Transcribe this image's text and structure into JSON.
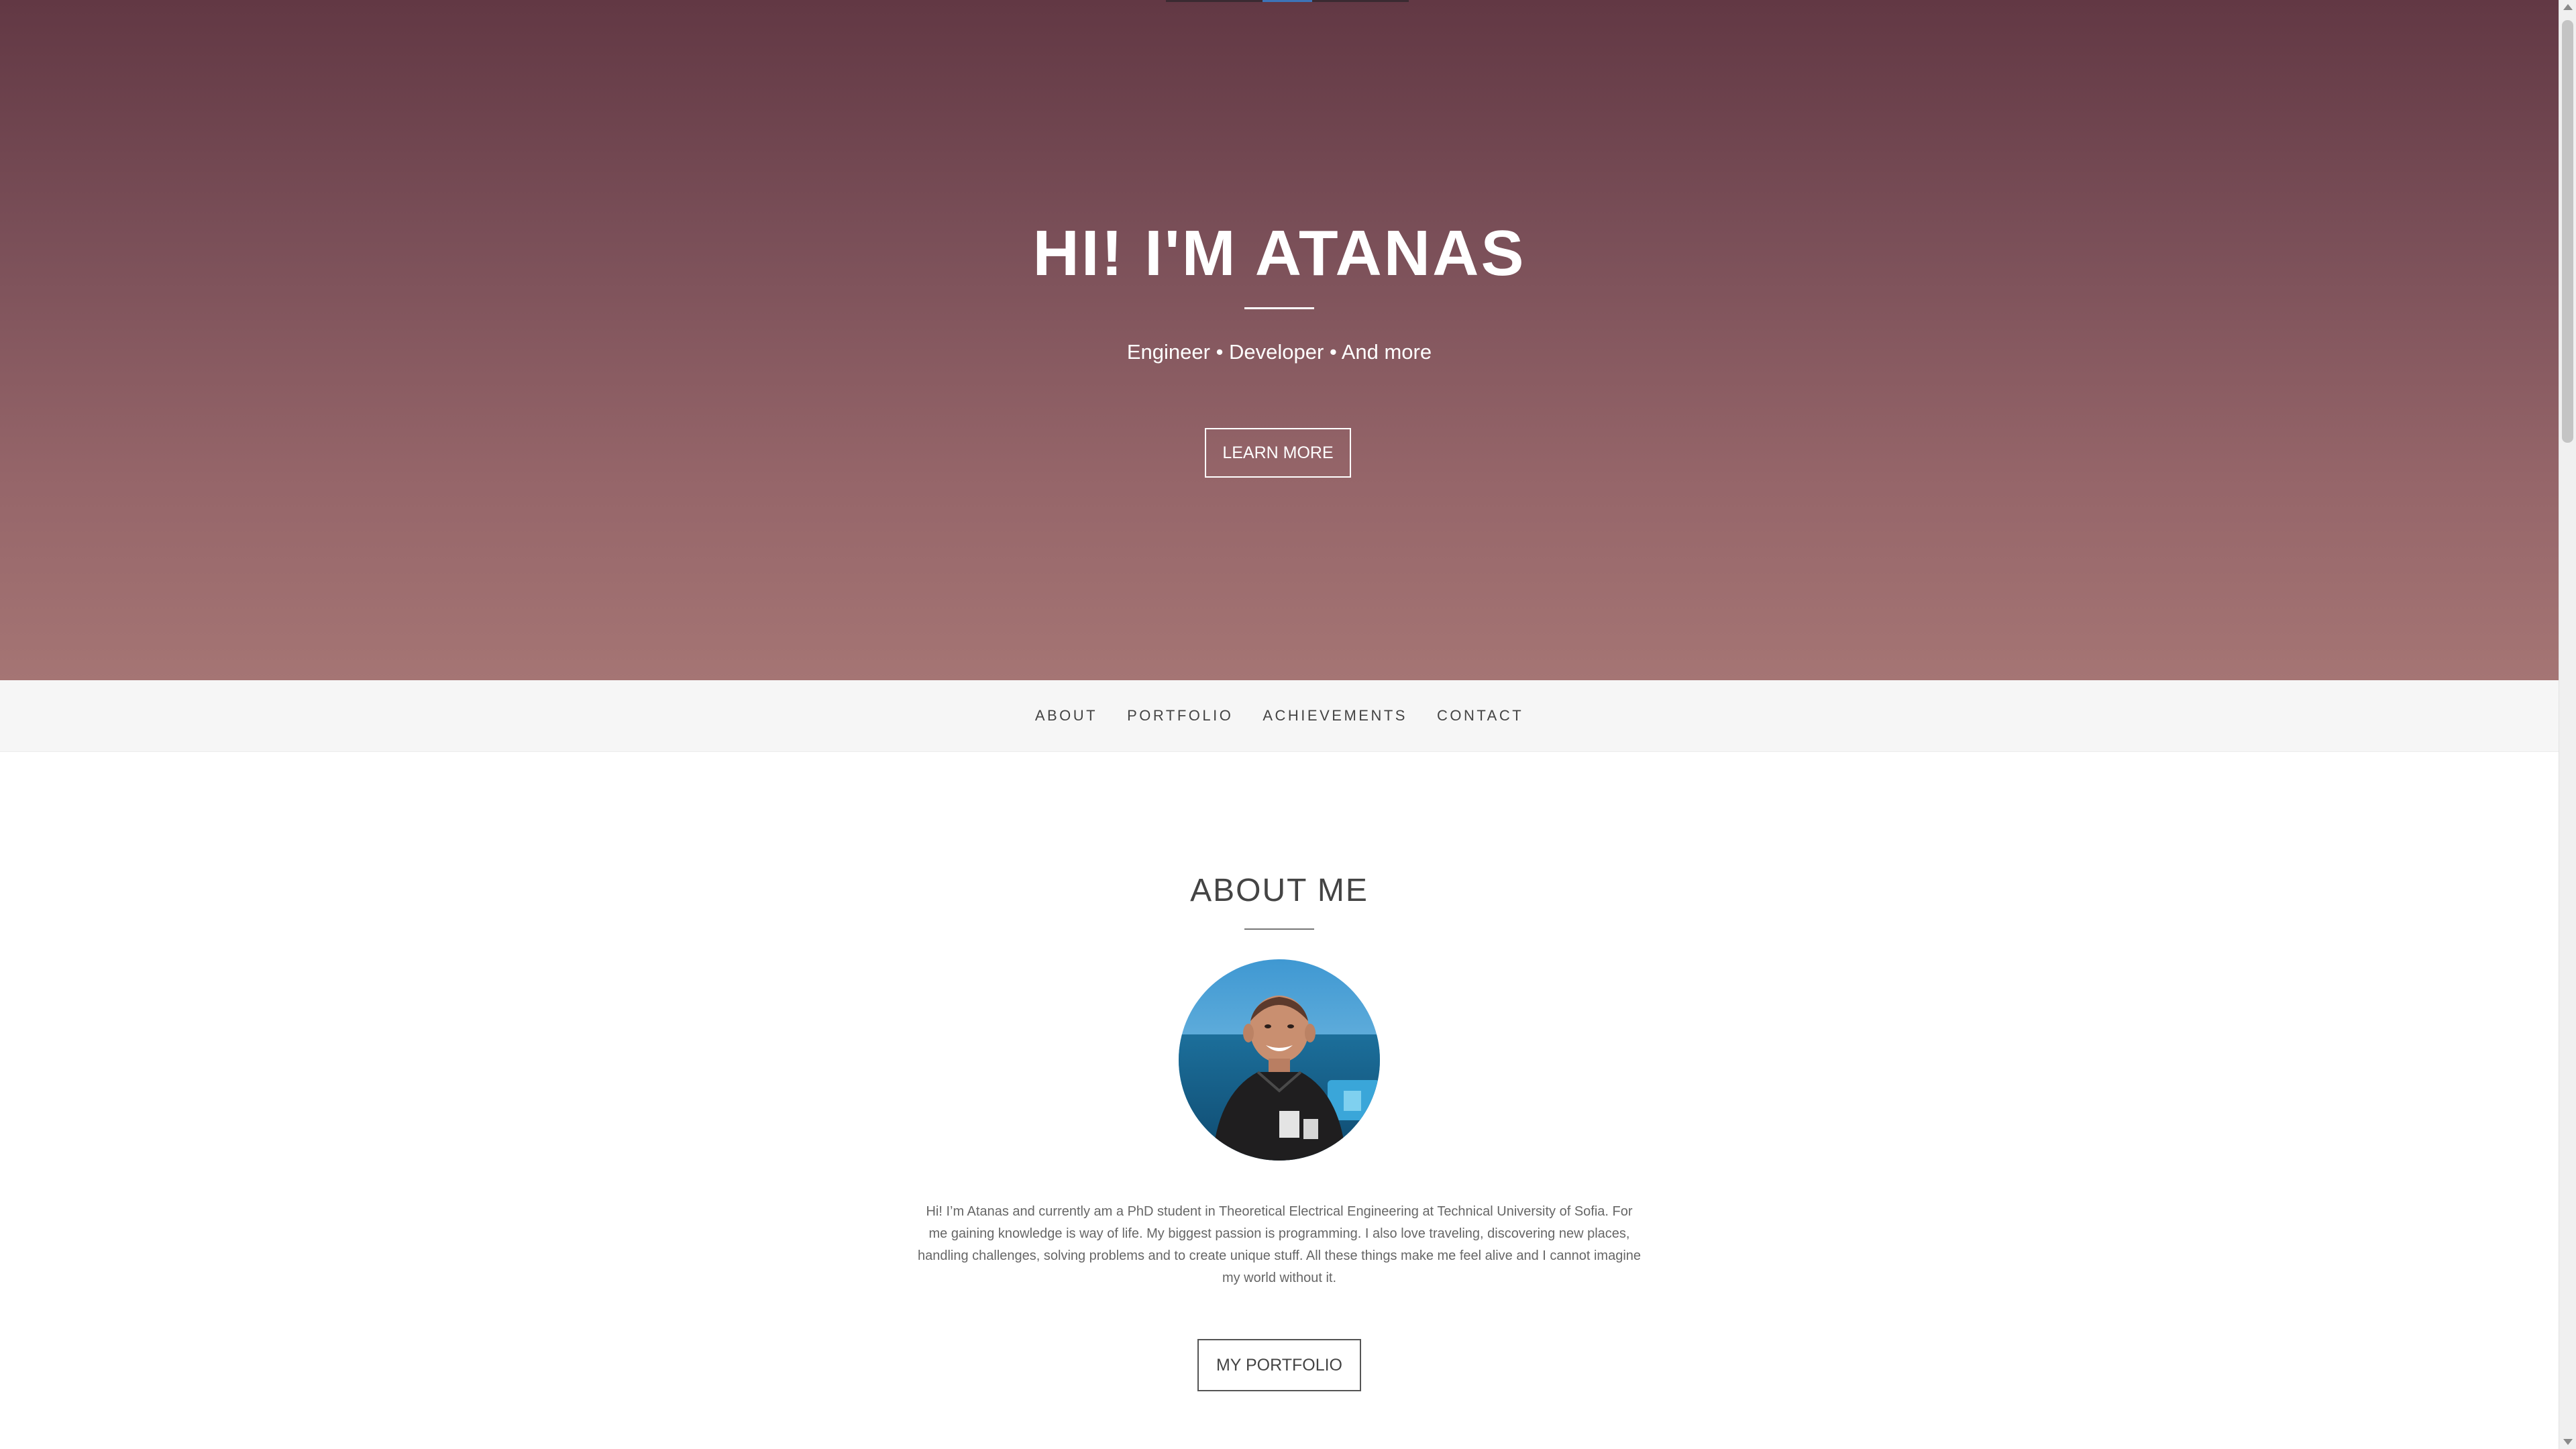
{
  "hero": {
    "title": "HI! I'M ATANAS",
    "subtitle": "Engineer • Developer • And more",
    "button_label": "LEARN MORE"
  },
  "nav": {
    "items": [
      {
        "label": "ABOUT"
      },
      {
        "label": "PORTFOLIO"
      },
      {
        "label": "ACHIEVEMENTS"
      },
      {
        "label": "CONTACT"
      }
    ]
  },
  "about": {
    "title": "ABOUT ME",
    "avatar_icon": "profile-photo",
    "text": "Hi! I’m Atanas and currently am a PhD student in Theoretical Electrical Engineering at Technical University of Sofia. For me gaining knowledge is way of life. My biggest passion is programming. I also love traveling, discovering new places, handling challenges, solving problems and to create unique stuff. All these things make me feel alive and I cannot imagine my world without it.",
    "button_label": "MY PORTFOLIO"
  },
  "colors": {
    "hero_top": "#623844",
    "hero_bottom": "#a57574",
    "nav_bg": "#f6f6f6",
    "accent_blue": "#3d74b8"
  }
}
